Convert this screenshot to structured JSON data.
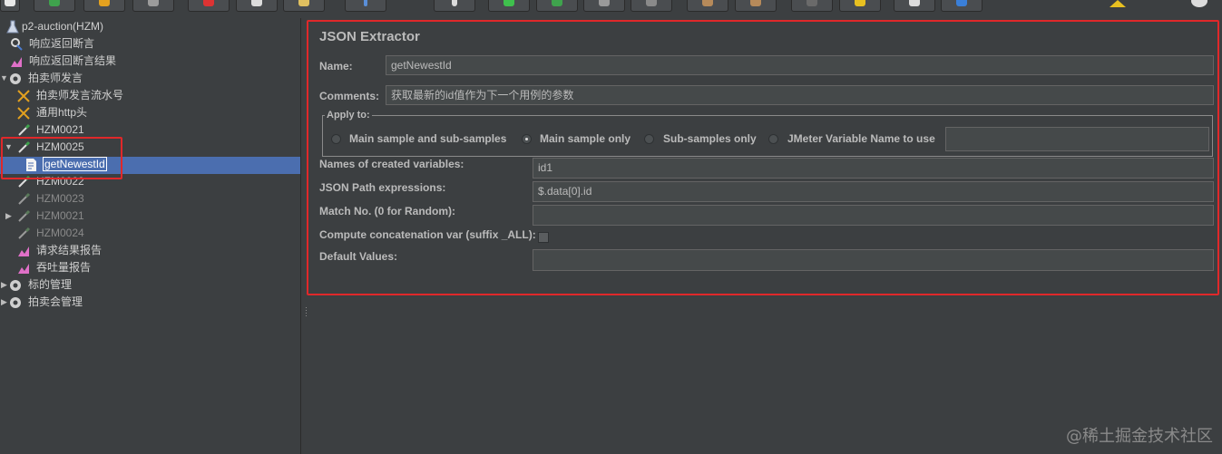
{
  "tree": {
    "items": [
      {
        "label": "p2-auction(HZM)",
        "icon": "flask-icon"
      },
      {
        "label": "响应返回断言",
        "icon": "magnifier-icon"
      },
      {
        "label": "响应返回断言结果",
        "icon": "graph-icon"
      },
      {
        "label": "拍卖师发言",
        "icon": "gear-icon"
      },
      {
        "label": "拍卖师发言流水号",
        "icon": "tools-icon"
      },
      {
        "label": "通用http头",
        "icon": "tools-icon"
      },
      {
        "label": "HZM0021",
        "icon": "pipette-icon"
      },
      {
        "label": "HZM0025",
        "icon": "pipette-icon"
      },
      {
        "label": "getNewestId",
        "icon": "document-icon"
      },
      {
        "label": "HZM0022",
        "icon": "pipette-icon"
      },
      {
        "label": "HZM0023",
        "icon": "pipette-icon"
      },
      {
        "label": "HZM0021",
        "icon": "pipette-icon"
      },
      {
        "label": "HZM0024",
        "icon": "pipette-icon"
      },
      {
        "label": "请求结果报告",
        "icon": "graph-icon"
      },
      {
        "label": "吞吐量报告",
        "icon": "graph-icon"
      },
      {
        "label": "标的管理",
        "icon": "gear-icon"
      },
      {
        "label": "拍卖会管理",
        "icon": "gear-icon"
      }
    ]
  },
  "panel": {
    "title": "JSON Extractor",
    "name_label": "Name:",
    "name_value": "getNewestId",
    "comments_label": "Comments:",
    "comments_value": "获取最新的id值作为下一个用例的参数",
    "apply_to_label": "Apply to:",
    "apply_options": [
      {
        "label": "Main sample and sub-samples",
        "selected": false
      },
      {
        "label": "Main sample only",
        "selected": true
      },
      {
        "label": "Sub-samples only",
        "selected": false
      },
      {
        "label": "JMeter Variable Name to use",
        "selected": false
      }
    ],
    "jmeter_var_value": "",
    "vars_label": "Names of created variables:",
    "vars_value": "id1",
    "json_path_label": "JSON Path expressions:",
    "json_path_value": "$.data[0].id",
    "match_no_label": "Match No. (0 for Random):",
    "match_no_value": "",
    "concat_label": "Compute concatenation var (suffix _ALL):",
    "concat_checked": false,
    "default_label": "Default Values:",
    "default_value": ""
  },
  "colors": {
    "background": "#3c3f41",
    "selection": "#4b6eaf",
    "highlight": "#e0282a"
  },
  "watermark": "@稀土掘金技术社区"
}
